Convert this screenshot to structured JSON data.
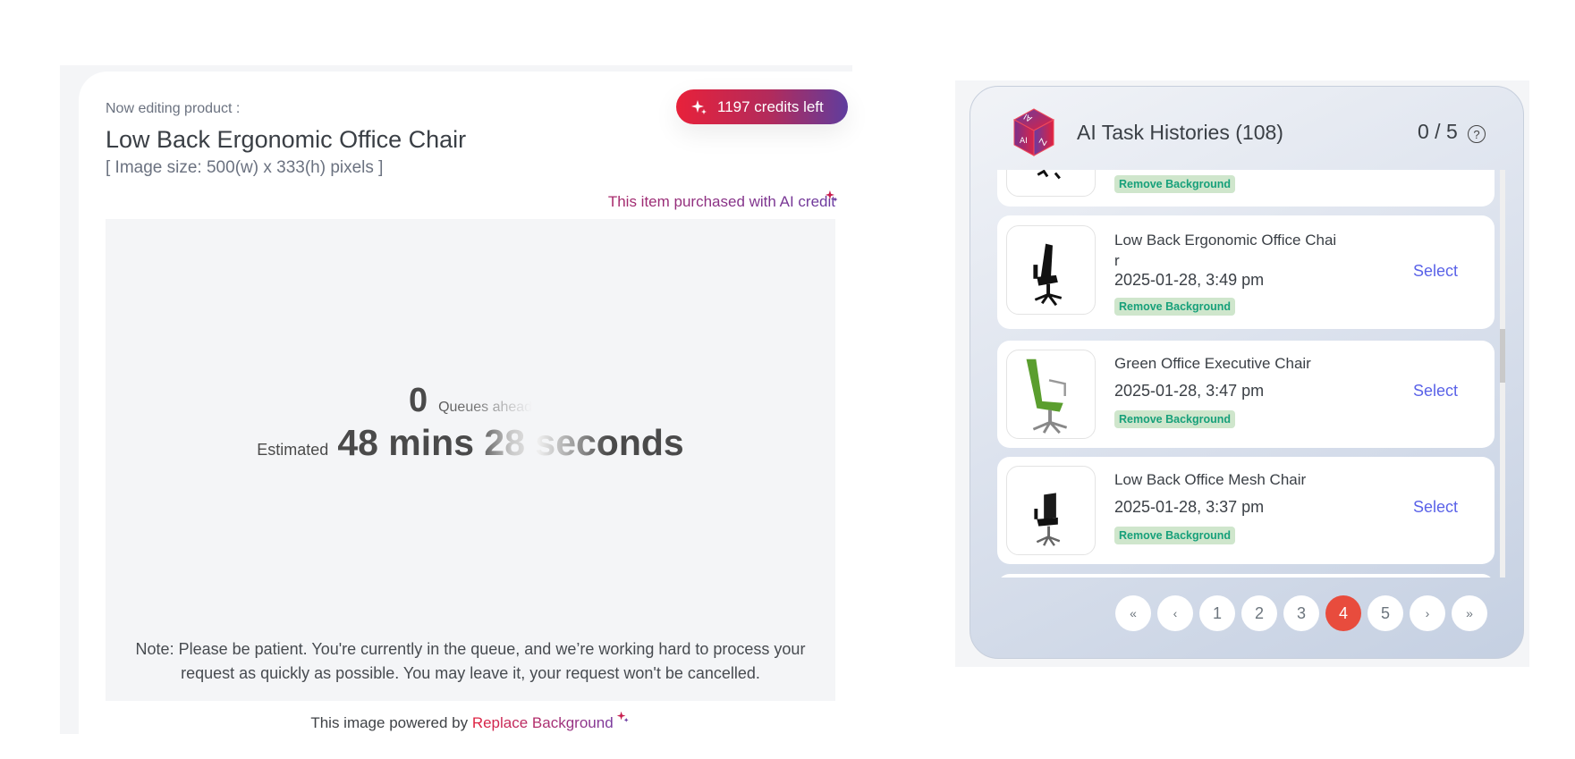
{
  "editor": {
    "editing_label": "Now editing product :",
    "product_title": "Low Back Ergonomic Office Chair",
    "image_size": "[ Image size: 500(w) x 333(h) pixels ]",
    "credits_badge": "1197 credits left",
    "ai_credit_note": "This item purchased with AI credit",
    "queue": {
      "count": "0",
      "count_label": "Queues ahead",
      "estimated_label": "Estimated",
      "estimated_value": "48 mins 28 seconds",
      "note": "Note: Please be patient. You're currently in the queue, and we’re working hard to process your request as quickly as possible. You may leave it, your request won't be cancelled."
    },
    "footer": {
      "prefix": "This image powered by",
      "link": "Replace Background"
    }
  },
  "history": {
    "title": "AI Task Histories (108)",
    "quota": "0 / 5",
    "help": "?",
    "items": [
      {
        "name": "",
        "date": "",
        "badge": "Remove Background",
        "select": "",
        "thumb": "black-chair"
      },
      {
        "name": "Low Back Ergonomic Office Chair",
        "date": "2025-01-28, 3:49 pm",
        "badge": "Remove Background",
        "select": "Select",
        "thumb": "black-chair"
      },
      {
        "name": "Green Office Executive Chair",
        "date": "2025-01-28, 3:47 pm",
        "badge": "Remove Background",
        "select": "Select",
        "thumb": "green-chair"
      },
      {
        "name": "Low Back Office Mesh Chair",
        "date": "2025-01-28, 3:37 pm",
        "badge": "Remove Background",
        "select": "Select",
        "thumb": "mesh-chair"
      }
    ],
    "pagination": {
      "first": "«",
      "prev": "‹",
      "pages": [
        "1",
        "2",
        "3",
        "4",
        "5"
      ],
      "current": "4",
      "next": "›",
      "last": "»"
    }
  },
  "colors": {
    "accent_red": "#e84c3d",
    "select_link": "#5a62e8",
    "badge_bg": "#cfe6cc",
    "badge_text": "#17a07a"
  }
}
